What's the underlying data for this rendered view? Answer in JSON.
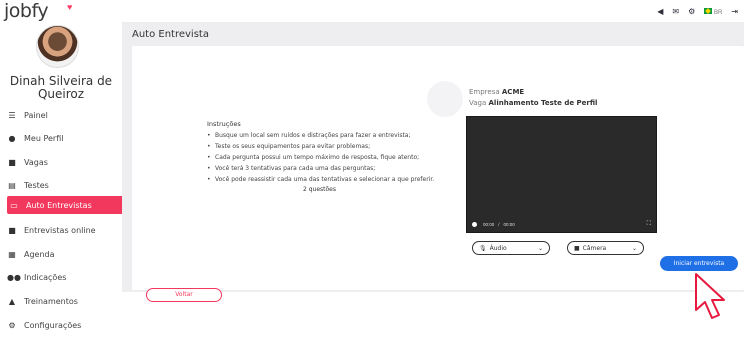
{
  "app": {
    "logo_text": "jobfy"
  },
  "topbar": {
    "lang_label": "BR"
  },
  "user": {
    "name": "Dinah Silveira de Queiroz"
  },
  "sidebar": {
    "items": [
      {
        "label": "Painel",
        "icon": "sliders-icon"
      },
      {
        "label": "Meu Perfil",
        "icon": "user-icon"
      },
      {
        "label": "Vagas",
        "icon": "briefcase-icon"
      },
      {
        "label": "Testes",
        "icon": "clipboard-icon"
      },
      {
        "label": "Auto Entrevistas",
        "icon": "chat-icon",
        "active": true
      },
      {
        "label": "Entrevistas online",
        "icon": "video-icon"
      },
      {
        "label": "Agenda",
        "icon": "calendar-icon"
      },
      {
        "label": "Indicações",
        "icon": "users-icon"
      },
      {
        "label": "Treinamentos",
        "icon": "graduation-icon"
      },
      {
        "label": "Configurações",
        "icon": "gear-icon"
      }
    ]
  },
  "main": {
    "title": "Auto Entrevista",
    "company_label": "Empresa",
    "company_name": "ACME",
    "job_label": "Vaga",
    "job_name": "Alinhamento Teste de Perfil",
    "instructions_title": "Instruções",
    "instructions": [
      "Busque um local sem ruídos e distrações para fazer a entrevista;",
      "Teste os seus equipamentos para evitar problemas;",
      "Cada pergunta possui um tempo máximo de resposta, fique atento;",
      "Você terá 3 tentativas para cada uma das perguntas;",
      "Você pode reassistir cada uma das tentativas e selecionar a que preferir."
    ],
    "questions_count": "2 questões",
    "video": {
      "current_time": "00:00",
      "separator": "/",
      "duration": "00:00"
    },
    "audio_select": "Áudio",
    "camera_select": "Câmera",
    "back_button": "Voltar",
    "start_button": "Iniciar entrevista"
  },
  "colors": {
    "accent": "#f2385d",
    "primary_button": "#1f6fe6"
  }
}
